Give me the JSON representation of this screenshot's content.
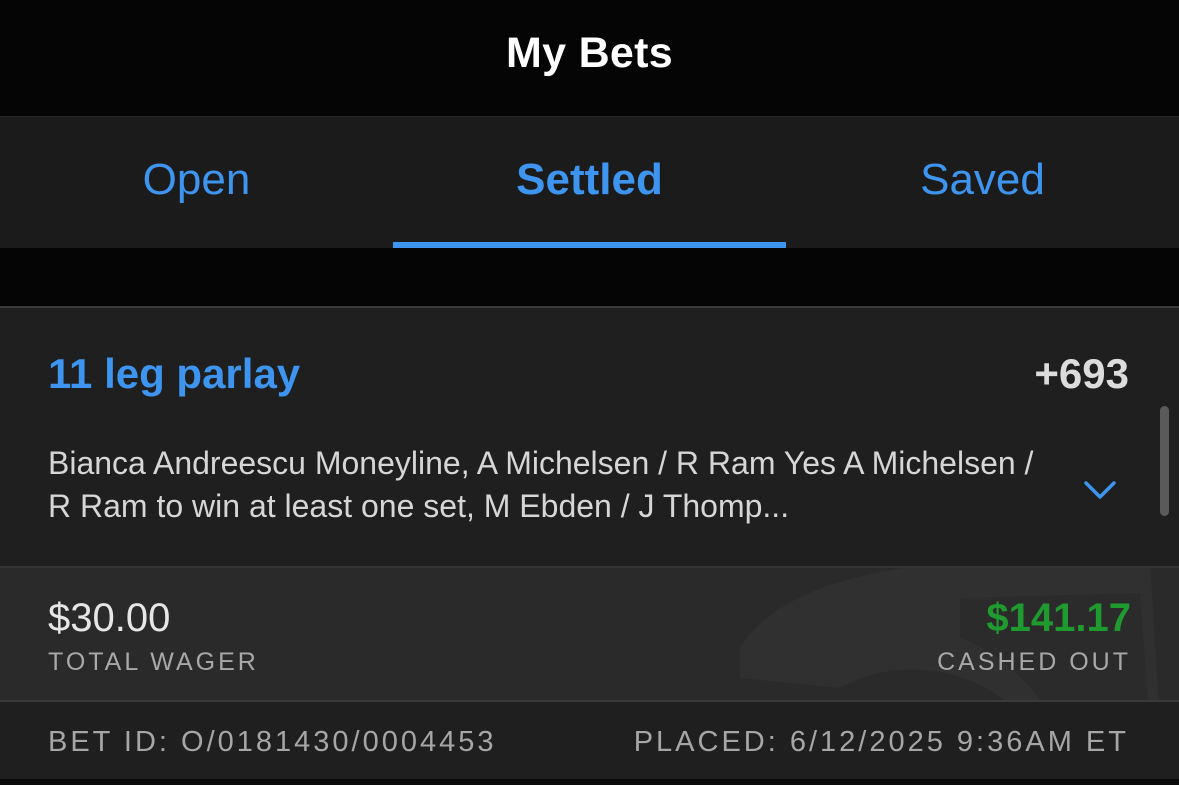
{
  "header": {
    "title": "My Bets"
  },
  "tabs": [
    {
      "label": "Open",
      "active": false
    },
    {
      "label": "Settled",
      "active": true
    },
    {
      "label": "Saved",
      "active": false
    }
  ],
  "bet": {
    "title": "11 leg parlay",
    "odds": "+693",
    "description": "Bianca Andreescu Moneyline, A Michelsen / R Ram Yes A Michelsen / R Ram to win at least one set, M Ebden / J Thomp...",
    "expand_icon": "chevron-down-icon",
    "wager_amount": "$30.00",
    "wager_label": "TOTAL WAGER",
    "payout_amount": "$141.17",
    "payout_label": "CASHED OUT",
    "bet_id": "BET ID: O/0181430/0004453",
    "placed": "PLACED: 6/12/2025 9:36AM ET"
  },
  "colors": {
    "accent": "#3d95f0",
    "payout": "#1f9a2e",
    "background": "#000000",
    "card": "#1f1f20"
  }
}
